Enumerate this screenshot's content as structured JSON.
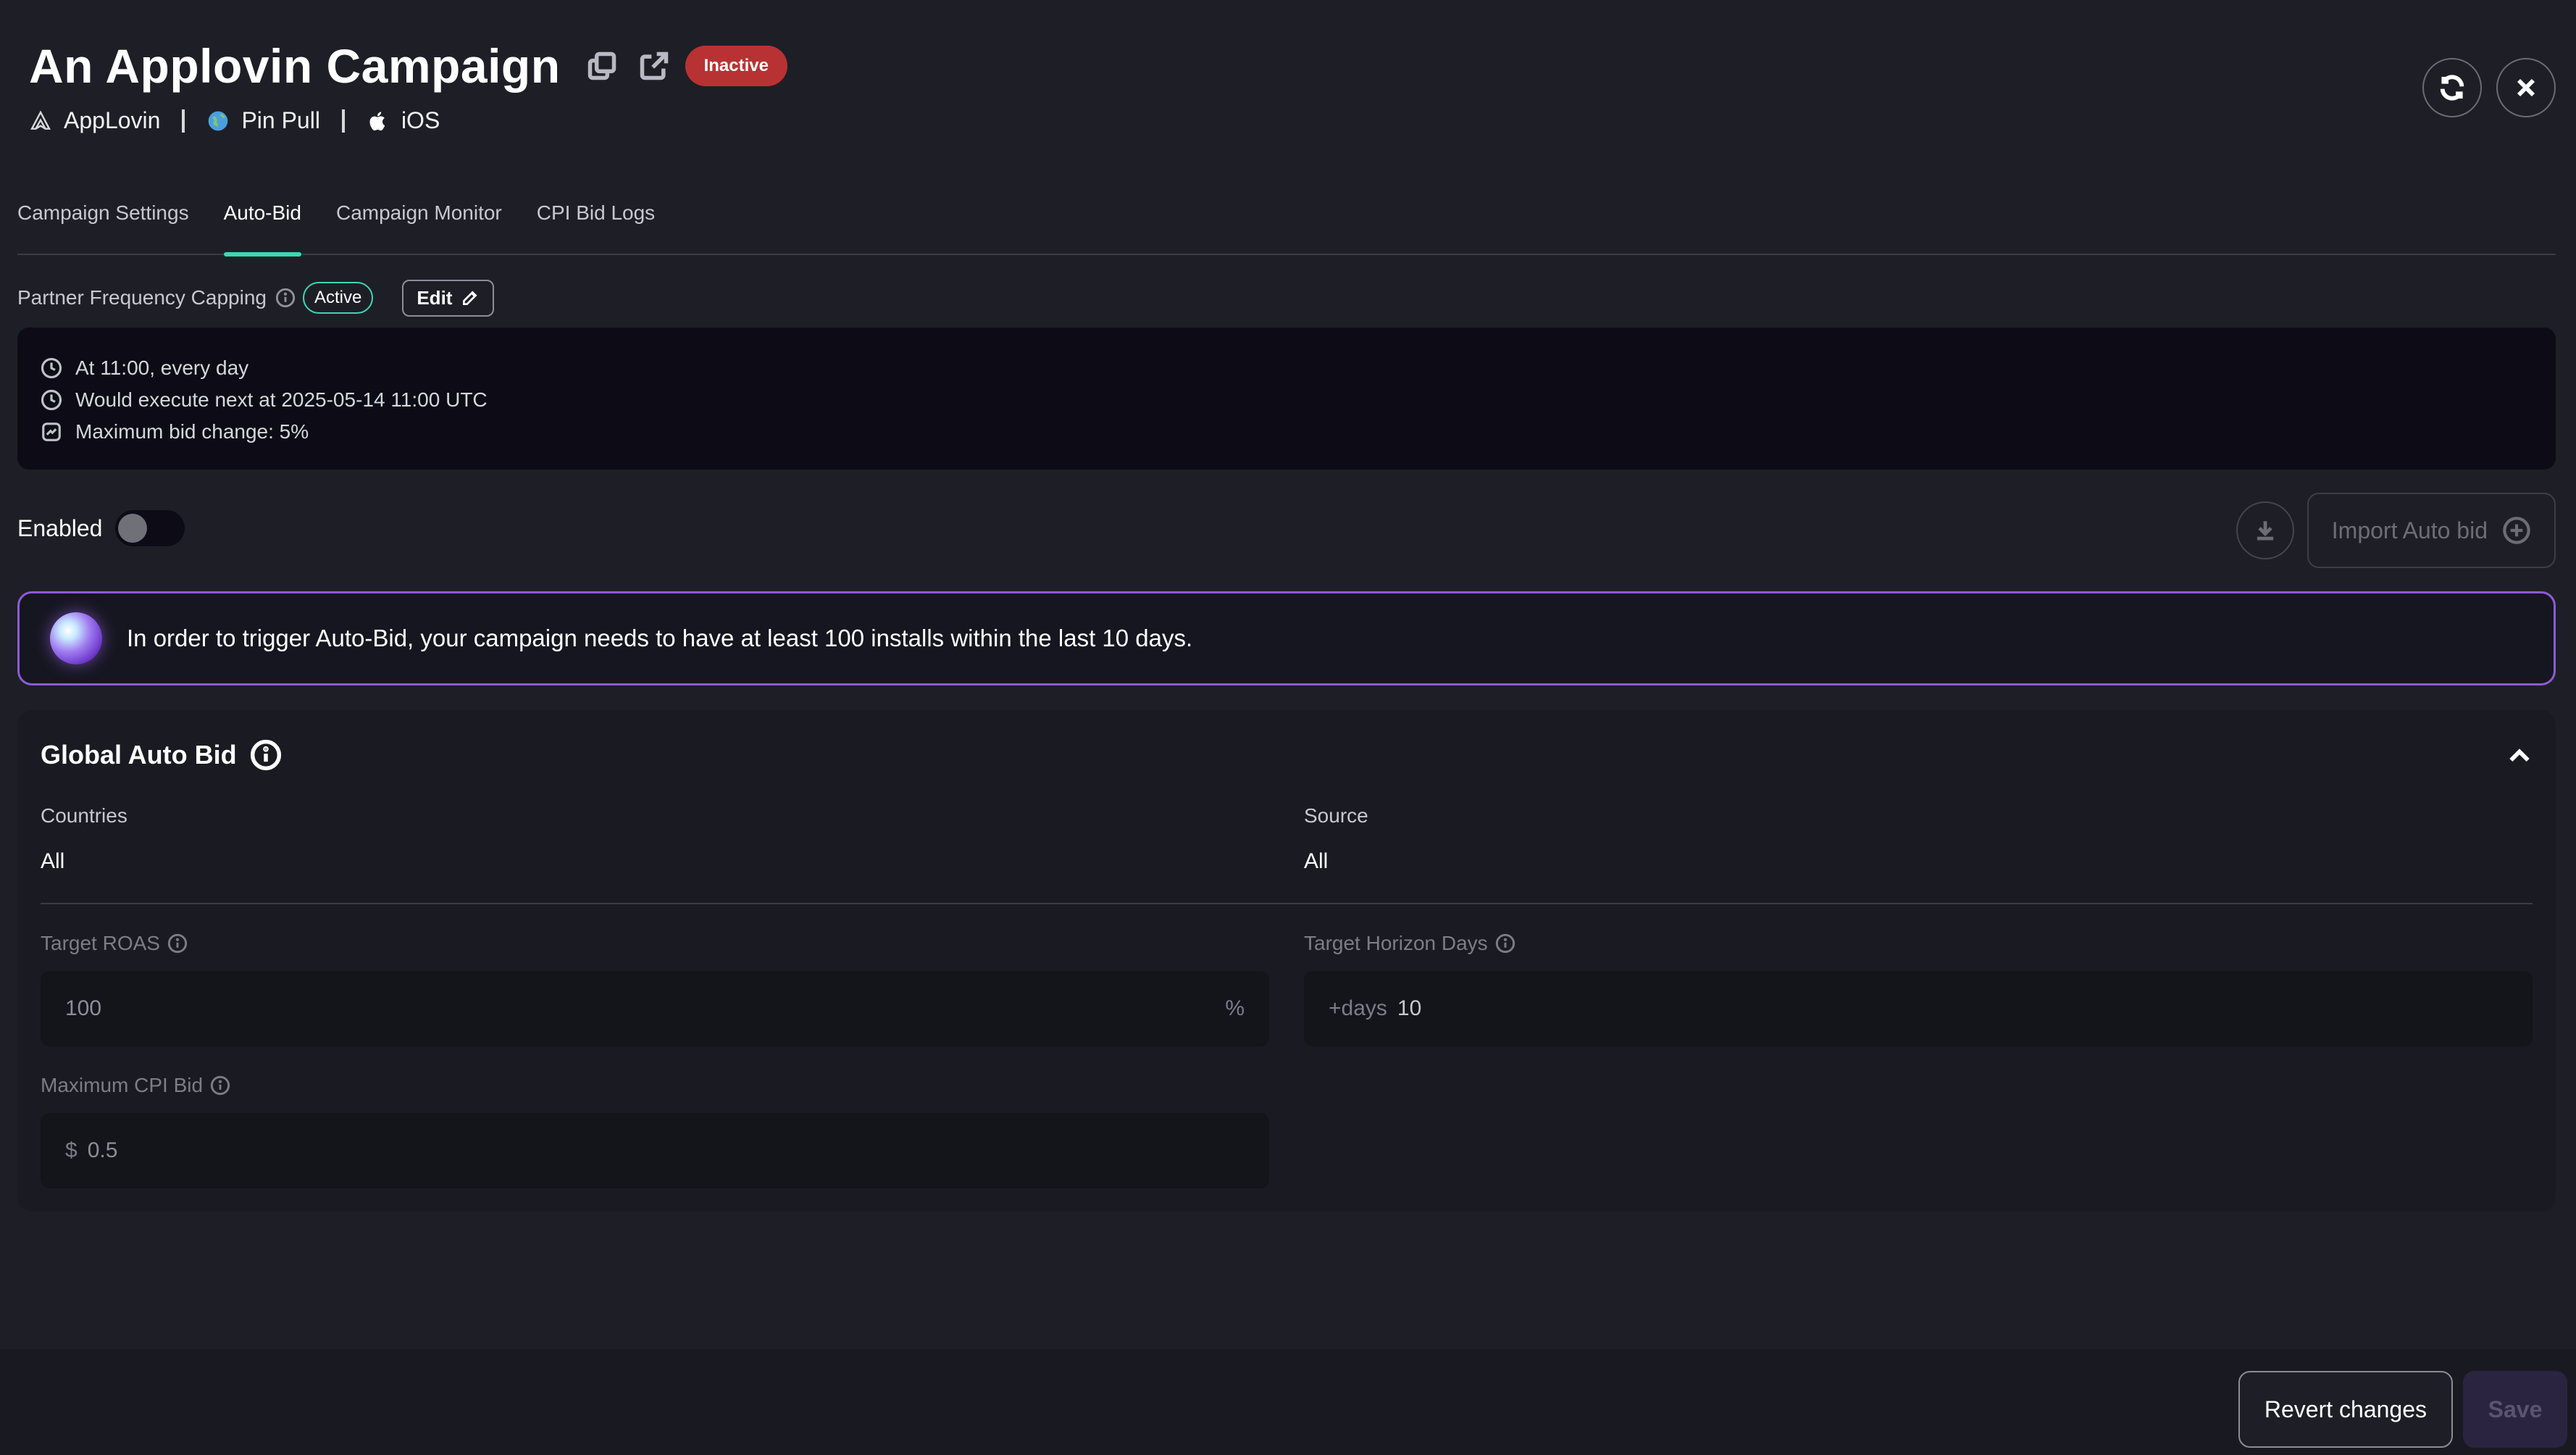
{
  "header": {
    "title": "An Applovin Campaign",
    "status": "Inactive",
    "meta": {
      "network": "AppLovin",
      "app": "Pin Pull",
      "platform": "iOS"
    }
  },
  "tabs": [
    {
      "label": "Campaign Settings",
      "active": false
    },
    {
      "label": "Auto-Bid",
      "active": true
    },
    {
      "label": "Campaign Monitor",
      "active": false
    },
    {
      "label": "CPI Bid Logs",
      "active": false
    }
  ],
  "frequency": {
    "label": "Partner Frequency Capping",
    "status": "Active",
    "edit_label": "Edit",
    "schedule": [
      "At 11:00, every day",
      "Would execute next at 2025-05-14 11:00 UTC",
      "Maximum bid change: 5%"
    ]
  },
  "enabled": {
    "label": "Enabled",
    "value": false
  },
  "import": {
    "label": "Import Auto bid"
  },
  "notice": {
    "text": "In order to trigger Auto-Bid, your campaign needs to have at least 100 installs within the last 10 days."
  },
  "global_bid": {
    "title": "Global Auto Bid",
    "countries_label": "Countries",
    "countries_value": "All",
    "source_label": "Source",
    "source_value": "All",
    "target_roas_label": "Target ROAS",
    "target_roas_value": "100",
    "target_roas_suffix": "%",
    "horizon_label": "Target Horizon Days",
    "horizon_prefix": "+days",
    "horizon_value": "10",
    "max_cpi_label": "Maximum CPI Bid",
    "max_cpi_prefix": "$",
    "max_cpi_value": "0.5"
  },
  "footer": {
    "revert_label": "Revert changes",
    "save_label": "Save"
  },
  "colors": {
    "background": "#1e1f26",
    "accent_teal": "#3fd6b4",
    "inactive_red": "#b83234",
    "notice_border": "#8d5bd6"
  }
}
